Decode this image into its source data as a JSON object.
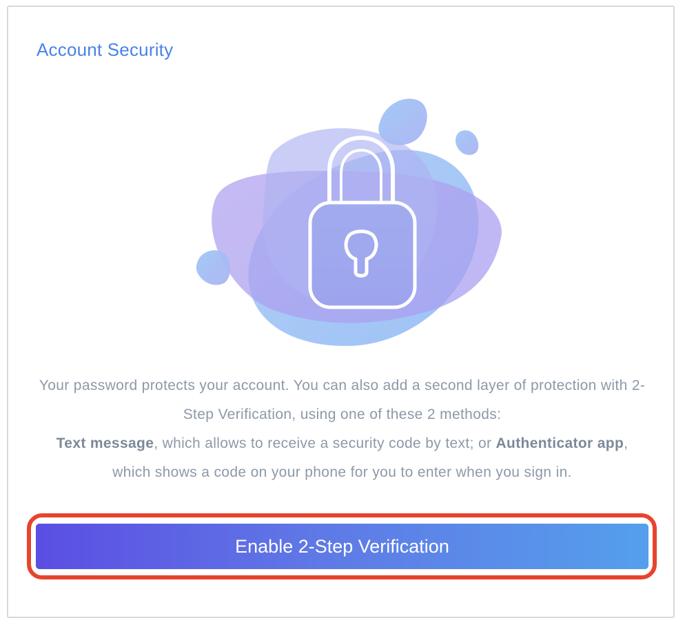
{
  "header": {
    "title": "Account Security"
  },
  "illustration": {
    "icon": "lock-icon"
  },
  "description": {
    "intro": "Your password protects your account. You can also add a second layer of protection with 2-Step Verification, using one of these 2 methods:",
    "method1_name": "Text message",
    "method1_text": ", which allows to receive a security code by text; or ",
    "method2_name": "Authenticator app",
    "method2_text": ", which shows a code on your phone for you to enter when you sign in."
  },
  "actions": {
    "enable_label": "Enable 2-Step Verification"
  },
  "colors": {
    "title": "#4a82e8",
    "body_text": "#8d99a8",
    "highlight": "#e8432e",
    "button_gradient_start": "#5b4ee3",
    "button_gradient_end": "#559fec"
  }
}
